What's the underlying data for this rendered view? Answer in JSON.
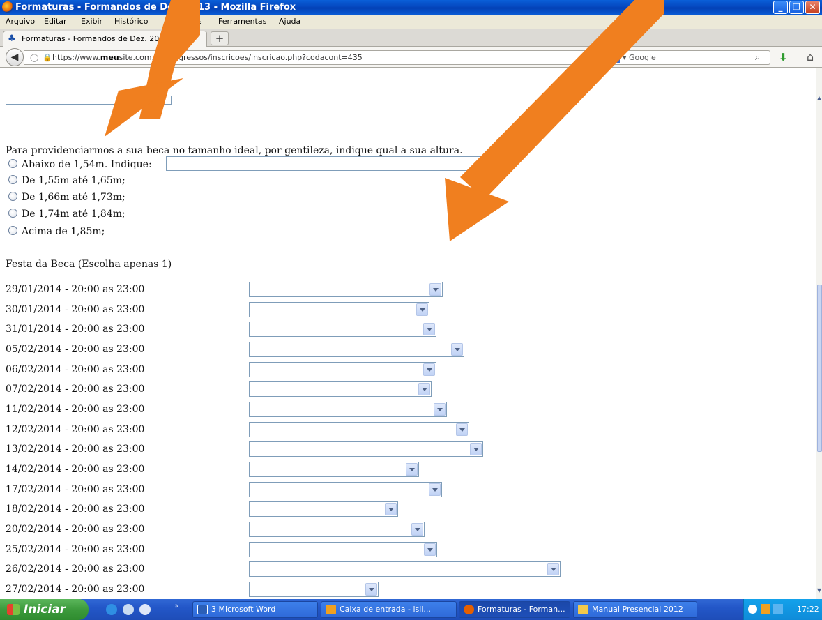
{
  "window": {
    "title": "Formaturas - Formandos de Dez. 2013 - Mozilla Firefox",
    "minimize": "_",
    "restore": "❐",
    "close": "✕"
  },
  "menu": [
    "Arquivo",
    "Editar",
    "Exibir",
    "Histórico",
    "Favoritos",
    "Ferramentas",
    "Ajuda"
  ],
  "tab": {
    "label": "Formaturas - Formandos de Dez. 2013",
    "new_tab": "+"
  },
  "nav": {
    "url_prefix": "https://www.",
    "url_host": "meu",
    "url_rest": "site.com.br/congressos/inscricoes/inscricao.php?codacont=435",
    "search_placeholder": "Google"
  },
  "form": {
    "question": "Para providenciarmos a sua beca no tamanho ideal, por gentileza, indique qual a sua altura.",
    "height_options": [
      "Abaixo de 1,54m. Indique:",
      "De 1,55m até 1,65m;",
      "De 1,66m até 1,73m;",
      "De 1,74m até 1,84m;",
      "Acima de 1,85m;"
    ],
    "festa_title": "Festa da Beca (Escolha apenas 1)",
    "dates": [
      "29/01/2014 - 20:00 as 23:00",
      "30/01/2014 - 20:00 as 23:00",
      "31/01/2014 - 20:00 as 23:00",
      "05/02/2014 - 20:00 as 23:00",
      "06/02/2014 - 20:00 as 23:00",
      "07/02/2014 - 20:00 as 23:00",
      "11/02/2014 - 20:00 as 23:00",
      "12/02/2014 - 20:00 as 23:00",
      "13/02/2014 - 20:00 as 23:00",
      "14/02/2014 - 20:00 as 23:00",
      "17/02/2014 - 20:00 as 23:00",
      "18/02/2014 - 20:00 as 23:00",
      "20/02/2014 - 20:00 as 23:00",
      "25/02/2014 - 20:00 as 23:00",
      "26/02/2014 - 20:00 as 23:00",
      "27/02/2014 - 20:00 as 23:00"
    ]
  },
  "taskbar": {
    "start": "Iniciar",
    "more": "»",
    "tasks": [
      "3 Microsoft Word",
      "Caixa de entrada - isil...",
      "Formaturas - Forman...",
      "Manual Presencial 2012"
    ],
    "clock": "17:22"
  },
  "colors": {
    "arrow": "#f07f1f",
    "titlebar": "#0548c0",
    "taskbar": "#2357c8",
    "start": "#3c9a3c"
  },
  "icons": [
    "firefox-icon",
    "shield-icon",
    "lock-icon",
    "star-icon",
    "google-icon",
    "magnifier-icon",
    "download-icon",
    "home-icon",
    "dropdown-arrow-icon",
    "windows-flag-icon"
  ]
}
